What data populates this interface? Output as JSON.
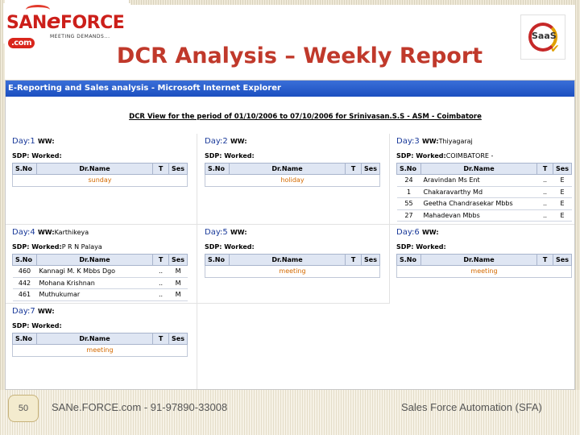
{
  "logo": {
    "brand_prefix": "SAN",
    "brand_e": "e",
    "brand_suffix": "FORCE",
    "brand_com": ".com",
    "tagline": "MEETING DEMANDS..."
  },
  "saas_badge": {
    "text": "SaaS"
  },
  "slide_title": "DCR Analysis – Weekly Report",
  "browser": {
    "title": "E-Reporting and Sales analysis - Microsoft Internet Explorer",
    "report_heading": "DCR View for the period of 01/10/2006 to 07/10/2006 for Srinivasan.S.S - ASM - Coimbatore",
    "columns": {
      "sno": "S.No",
      "name": "Dr.Name",
      "t": "T",
      "ses": "Ses"
    },
    "labels": {
      "day": "Day:",
      "ww": "WW:",
      "sdp": "SDP:",
      "worked": "Worked:"
    },
    "days": [
      {
        "num": "1",
        "ww": "",
        "worked": "",
        "note": "sunday",
        "rows": []
      },
      {
        "num": "2",
        "ww": "",
        "worked": "",
        "note": "holiday",
        "rows": []
      },
      {
        "num": "3",
        "ww": "Thiyagaraj",
        "worked": "COIMBATORE -",
        "note": "",
        "rows": [
          {
            "sno": "24",
            "name": "Aravindan Ms Ent",
            "t": "..",
            "ses": "E"
          },
          {
            "sno": "1",
            "name": "Chakaravarthy Md",
            "t": "..",
            "ses": "E"
          },
          {
            "sno": "55",
            "name": "Geetha Chandrasekar Mbbs",
            "t": "..",
            "ses": "E"
          },
          {
            "sno": "27",
            "name": "Mahadevan Mbbs",
            "t": "..",
            "ses": "E"
          }
        ]
      },
      {
        "num": "4",
        "ww": "Karthikeya",
        "worked": "P R N Palaya",
        "note": "",
        "rows": [
          {
            "sno": "460",
            "name": "Kannagi M. K Mbbs Dgo",
            "t": "..",
            "ses": "M"
          },
          {
            "sno": "442",
            "name": "Mohana Krishnan",
            "t": "..",
            "ses": "M"
          },
          {
            "sno": "461",
            "name": "Muthukumar",
            "t": "..",
            "ses": "M"
          }
        ]
      },
      {
        "num": "5",
        "ww": "",
        "worked": "",
        "note": "meeting",
        "rows": []
      },
      {
        "num": "6",
        "ww": "",
        "worked": "",
        "note": "meeting",
        "rows": []
      },
      {
        "num": "7",
        "ww": "",
        "worked": "",
        "note": "meeting",
        "rows": []
      }
    ]
  },
  "footer": {
    "page_number": "50",
    "left_text": "SANe.FORCE.com - 91-97890-33008",
    "right_text": "Sales Force Automation (SFA)"
  },
  "colors": {
    "title_red": "#c0392b",
    "day_blue": "#1a3a9a",
    "note_orange": "#d46a00",
    "titlebar_blue": "#1b4fc0"
  }
}
